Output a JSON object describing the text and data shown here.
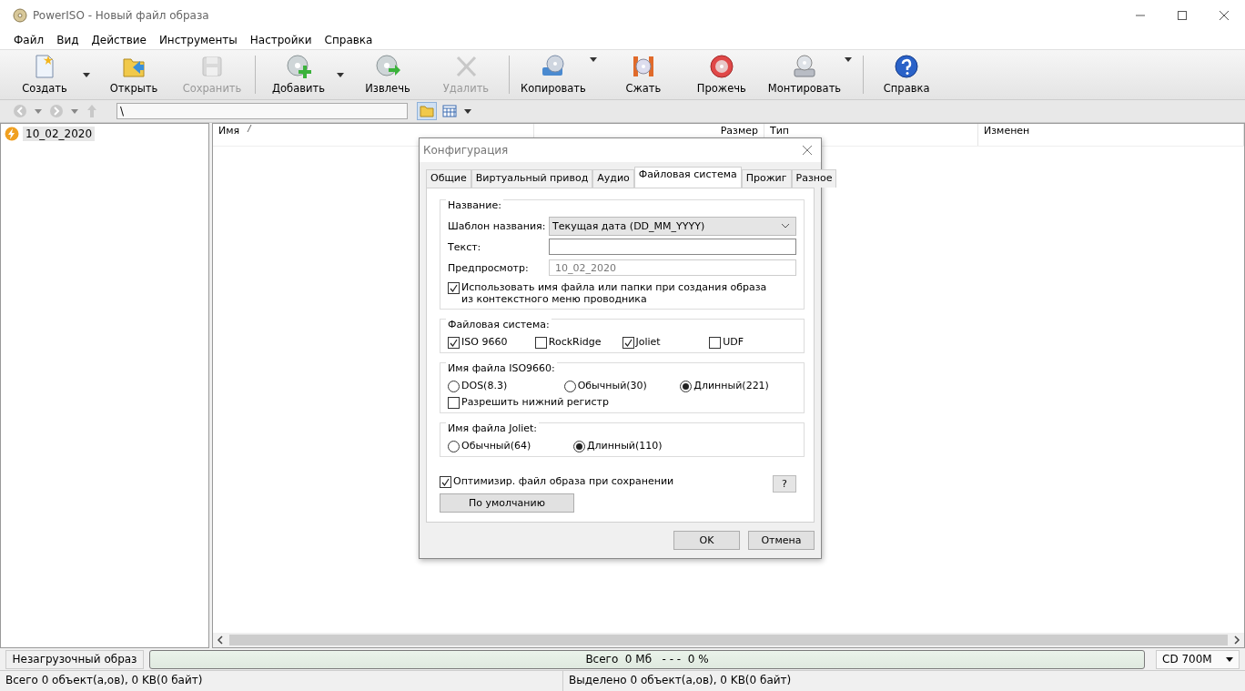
{
  "window": {
    "title": "PowerISO - Новый файл образа"
  },
  "menu": [
    "Файл",
    "Вид",
    "Действие",
    "Инструменты",
    "Настройки",
    "Справка"
  ],
  "toolbar": [
    {
      "label": "Создать",
      "disabled": false,
      "dropdown": true
    },
    {
      "label": "Открыть",
      "disabled": false,
      "dropdown": false
    },
    {
      "label": "Сохранить",
      "disabled": true,
      "dropdown": false
    },
    {
      "label": "Добавить",
      "disabled": false,
      "dropdown": true
    },
    {
      "label": "Извлечь",
      "disabled": false,
      "dropdown": false
    },
    {
      "label": "Удалить",
      "disabled": true,
      "dropdown": false
    },
    {
      "label": "Копировать",
      "disabled": false,
      "dropdown": true
    },
    {
      "label": "Сжать",
      "disabled": false,
      "dropdown": false
    },
    {
      "label": "Прожечь",
      "disabled": false,
      "dropdown": false
    },
    {
      "label": "Монтировать",
      "disabled": false,
      "dropdown": true
    },
    {
      "label": "Справка",
      "disabled": false,
      "dropdown": false
    }
  ],
  "address": {
    "value": "\\"
  },
  "tree": [
    {
      "label": "10_02_2020",
      "selected": true
    }
  ],
  "columns": [
    "Имя",
    "Размер",
    "Тип",
    "Изменен"
  ],
  "dialog": {
    "title": "Конфигурация",
    "tabs": [
      {
        "label": "Общие",
        "selected": false
      },
      {
        "label": "Виртуальный привод",
        "selected": false
      },
      {
        "label": "Аудио",
        "selected": false
      },
      {
        "label": "Файловая система",
        "selected": true
      },
      {
        "label": "Прожиг",
        "selected": false
      },
      {
        "label": "Разное",
        "selected": false
      }
    ],
    "name_group": {
      "legend": "Название:",
      "template_label": "Шаблон названия:",
      "template_value": "Текущая дата (DD_MM_YYYY)",
      "text_label": "Текст:",
      "preview_label": "Предпросмотр:",
      "preview_value": "10_02_2020",
      "use_name": {
        "label": "Использовать имя файла или папки при создания образа из контекстного меню проводника",
        "checked": true
      }
    },
    "fs_group": {
      "legend": "Файловая система:",
      "options": [
        {
          "label": "ISO 9660",
          "checked": true
        },
        {
          "label": "RockRidge",
          "checked": false
        },
        {
          "label": "Joliet",
          "checked": true
        },
        {
          "label": "UDF",
          "checked": false
        }
      ]
    },
    "iso_group": {
      "legend": "Имя файла ISO9660:",
      "options": [
        {
          "label": "DOS(8.3)",
          "selected": false
        },
        {
          "label": "Обычный(30)",
          "selected": false
        },
        {
          "label": "Длинный(221)",
          "selected": true
        }
      ],
      "lowercase": {
        "label": "Разрешить нижний регистр",
        "checked": false
      }
    },
    "joliet_group": {
      "legend": "Имя файла Joliet:",
      "options": [
        {
          "label": "Обычный(64)",
          "selected": false
        },
        {
          "label": "Длинный(110)",
          "selected": true
        }
      ]
    },
    "optimize": {
      "label": "Оптимизир. файл образа при сохранении",
      "checked": true
    },
    "help_button": "?",
    "default_button": "По умолчанию",
    "ok": "OK",
    "cancel": "Отмена"
  },
  "status": {
    "boot": "Незагрузочный образ",
    "progress_text": "Всего  0 Мб   - - -  0 %",
    "level": 0,
    "media": "CD 700M",
    "total": "Всего 0 объект(а,ов), 0 KB(0 байт)",
    "selected": "Выделено 0 объект(а,ов), 0 KB(0 байт)"
  }
}
